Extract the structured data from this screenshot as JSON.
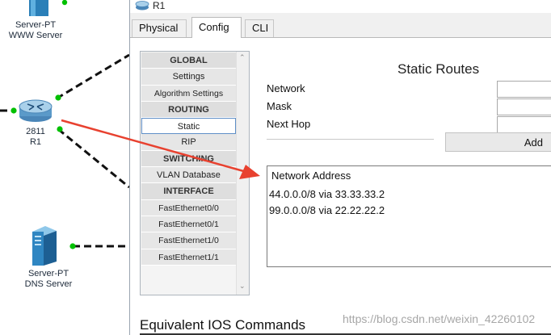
{
  "topology": {
    "devices": [
      {
        "name": "Server-PT",
        "subname": "WWW Server"
      },
      {
        "name": "2811",
        "subname": "R1"
      },
      {
        "name": "Server-PT",
        "subname": "DNS Server"
      }
    ]
  },
  "window": {
    "title": "R1",
    "tabs": [
      {
        "label": "Physical",
        "active": false
      },
      {
        "label": "Config",
        "active": true
      },
      {
        "label": "CLI",
        "active": false
      }
    ]
  },
  "nav": {
    "items": [
      {
        "label": "GLOBAL",
        "type": "header"
      },
      {
        "label": "Settings",
        "type": "item"
      },
      {
        "label": "Algorithm Settings",
        "type": "item"
      },
      {
        "label": "ROUTING",
        "type": "header"
      },
      {
        "label": "Static",
        "type": "item",
        "selected": true
      },
      {
        "label": "RIP",
        "type": "item"
      },
      {
        "label": "SWITCHING",
        "type": "header"
      },
      {
        "label": "VLAN Database",
        "type": "item"
      },
      {
        "label": "INTERFACE",
        "type": "header"
      },
      {
        "label": "FastEthernet0/0",
        "type": "item"
      },
      {
        "label": "FastEthernet0/1",
        "type": "item"
      },
      {
        "label": "FastEthernet1/0",
        "type": "item"
      },
      {
        "label": "FastEthernet1/1",
        "type": "item"
      }
    ]
  },
  "static_routes": {
    "title": "Static Routes",
    "network_label": "Network",
    "mask_label": "Mask",
    "next_hop_label": "Next Hop",
    "network_value": "",
    "mask_value": "",
    "next_hop_value": "",
    "add_label": "Add",
    "list_header": "Network Address",
    "routes": [
      "44.0.0.0/8 via 33.33.33.2",
      "99.0.0.0/8 via 22.22.22.2"
    ]
  },
  "ios": {
    "title": "Equivalent IOS Commands"
  },
  "watermark": "https://blog.csdn.net/weixin_42260102",
  "colors": {
    "link_up": "#00c000",
    "annotation_arrow": "#e8412f",
    "selection_border": "#5f8fc7"
  }
}
